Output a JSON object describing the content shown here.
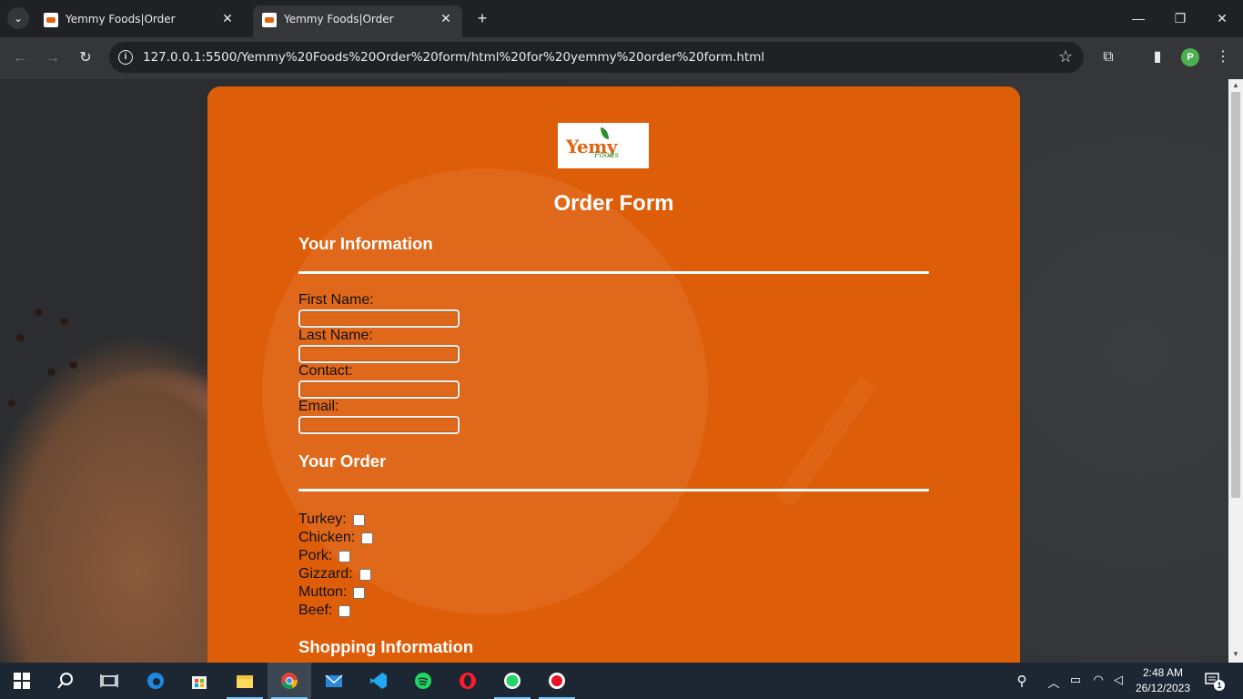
{
  "browser": {
    "tabs": [
      {
        "title": "Yemmy Foods|Order",
        "active": false
      },
      {
        "title": "Yemmy Foods|Order",
        "active": true
      }
    ],
    "url": "127.0.0.1:5500/Yemmy%20Foods%20Order%20form/html%20for%20yemmy%20order%20form.html",
    "profile_initial": "P"
  },
  "page": {
    "logo_text": "Yemy",
    "logo_sub": "Foods",
    "form_title": "Order Form",
    "section_info": "Your Information",
    "fields": [
      {
        "label": "First Name:",
        "value": ""
      },
      {
        "label": "Last Name:",
        "value": ""
      },
      {
        "label": "Contact:",
        "value": ""
      },
      {
        "label": "Email:",
        "value": ""
      }
    ],
    "section_order": "Your Order",
    "items": [
      {
        "label": "Turkey:",
        "checked": false
      },
      {
        "label": "Chicken:",
        "checked": false
      },
      {
        "label": "Pork:",
        "checked": false
      },
      {
        "label": "Gizzard:",
        "checked": false
      },
      {
        "label": "Mutton:",
        "checked": false
      },
      {
        "label": "Beef:",
        "checked": false
      }
    ],
    "section_shopping": "Shopping Information",
    "colors": {
      "card": "#de5d09",
      "heading": "#ffffff"
    }
  },
  "taskbar": {
    "apps": [
      "start-icon",
      "search-icon",
      "task-view-icon",
      "edge-icon",
      "store-icon",
      "file-explorer-icon",
      "chrome-icon",
      "mail-icon",
      "vscode-icon",
      "spotify-icon",
      "opera-icon",
      "whatsapp-icon",
      "recorder-icon"
    ],
    "time": "2:48 AM",
    "date": "26/12/2023",
    "notification_count": "1"
  }
}
